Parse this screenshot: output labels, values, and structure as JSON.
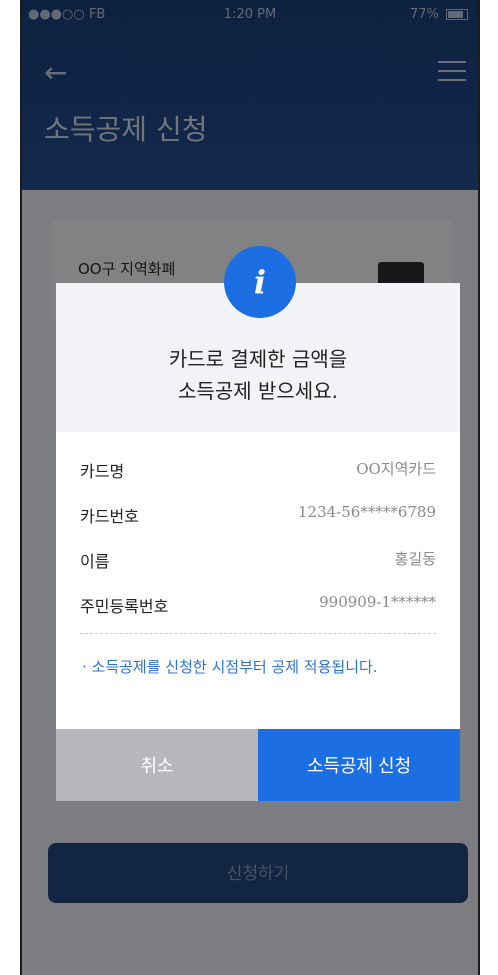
{
  "status_bar": {
    "carrier": "●●●○○ FB",
    "time": "1:20 PM",
    "battery": "77%"
  },
  "header": {
    "title": "소득공제 신청",
    "back_icon": "arrow-left-icon",
    "menu_icon": "hamburger-icon"
  },
  "background": {
    "card_name": "OO구 지역화폐",
    "apply_label": "신청하기"
  },
  "modal": {
    "headline_line1": "카드로 결제한 금액을",
    "headline_line2": "소득공제 받으세요.",
    "rows": [
      {
        "label": "카드명",
        "value": "OO지역카드"
      },
      {
        "label": "카드번호",
        "value": "1234-56*****6789"
      },
      {
        "label": "이름",
        "value": "홍길동"
      },
      {
        "label": "주민등록번호",
        "value": "990909-1******"
      }
    ],
    "note": "· 소득공제를 신청한 시점부터 공제 적용됩니다.",
    "cancel_label": "취소",
    "confirm_label": "소득공제 신청"
  },
  "colors": {
    "primary": "#1c6fe2",
    "header": "#1a3f78",
    "cancel": "#b6b8bd"
  }
}
